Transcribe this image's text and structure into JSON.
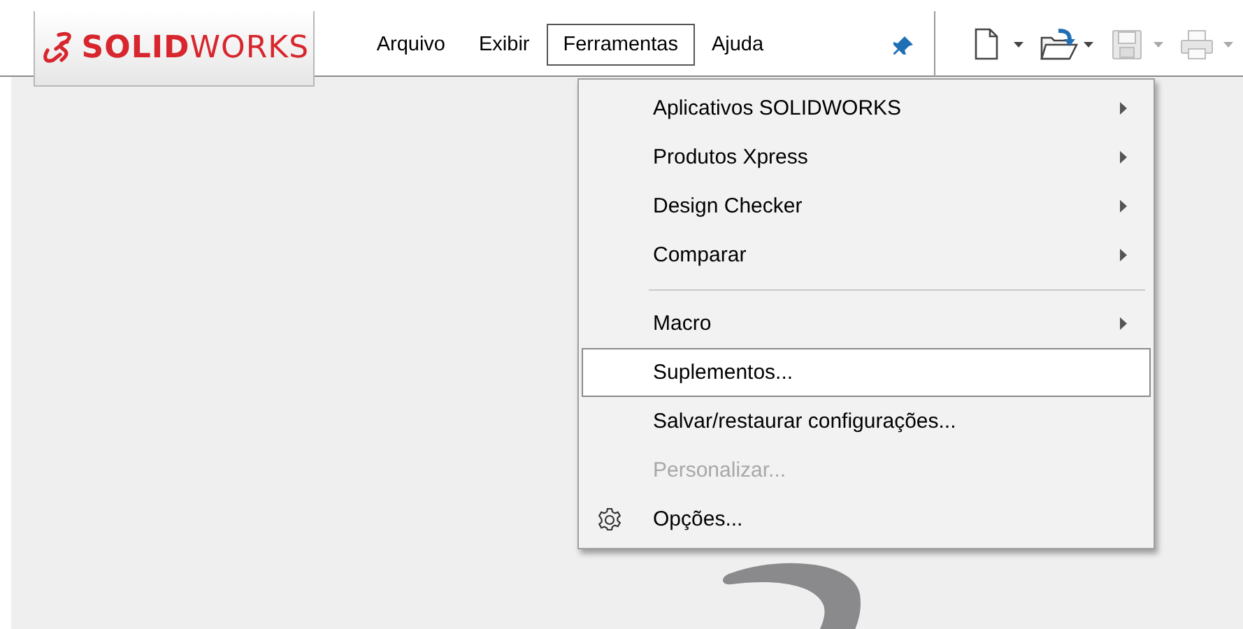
{
  "logo": {
    "brand": "**SOLID**WORKS"
  },
  "menu_bar": [
    {
      "label": "Arquivo",
      "selected": false
    },
    {
      "label": "Exibir",
      "selected": false
    },
    {
      "label": "Ferramentas",
      "selected": true
    },
    {
      "label": "Ajuda",
      "selected": false
    }
  ],
  "toolbar": [
    {
      "kind": "new",
      "disabled": false
    },
    {
      "kind": "open",
      "disabled": false
    },
    {
      "kind": "save",
      "disabled": true
    },
    {
      "kind": "print",
      "disabled": true
    }
  ],
  "dropdown": [
    {
      "kind": "item",
      "label": "Aplicativos SOLIDWORKS",
      "submenu": true,
      "selected": false,
      "disabled": false
    },
    {
      "kind": "item",
      "label": "Produtos Xpress",
      "submenu": true,
      "selected": false,
      "disabled": false
    },
    {
      "kind": "item",
      "label": "Design Checker",
      "submenu": true,
      "selected": false,
      "disabled": false
    },
    {
      "kind": "item",
      "label": "Comparar",
      "submenu": true,
      "selected": false,
      "disabled": false
    },
    {
      "kind": "separator"
    },
    {
      "kind": "item",
      "label": "Macro",
      "submenu": true,
      "selected": false,
      "disabled": false
    },
    {
      "kind": "item",
      "label": "Suplementos...",
      "submenu": false,
      "selected": true,
      "disabled": false
    },
    {
      "kind": "item",
      "label": "Salvar/restaurar configurações...",
      "submenu": false,
      "selected": false,
      "disabled": false
    },
    {
      "kind": "item",
      "label": "Personalizar...",
      "submenu": false,
      "selected": false,
      "disabled": true
    },
    {
      "kind": "settings",
      "label": "Opções...",
      "submenu": false,
      "selected": false,
      "disabled": false
    }
  ]
}
